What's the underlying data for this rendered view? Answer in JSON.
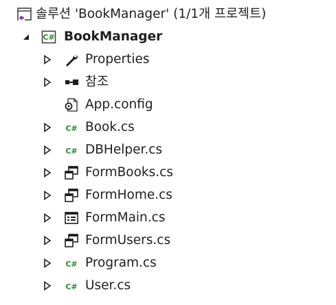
{
  "solution": {
    "label": "솔루션 'BookManager' (1/1개 프로젝트)",
    "icon": "solution-icon"
  },
  "project": {
    "label": "BookManager",
    "icon": "csharp-project-icon",
    "expanded": true
  },
  "items": [
    {
      "label": "Properties",
      "icon": "wrench-icon",
      "expander": true
    },
    {
      "label": "참조",
      "icon": "references-icon",
      "expander": true
    },
    {
      "label": "App.config",
      "icon": "config-file-icon",
      "expander": false
    },
    {
      "label": "Book.cs",
      "icon": "csharp-file-icon",
      "expander": true
    },
    {
      "label": "DBHelper.cs",
      "icon": "csharp-file-icon",
      "expander": true
    },
    {
      "label": "FormBooks.cs",
      "icon": "form-icon",
      "expander": true
    },
    {
      "label": "FormHome.cs",
      "icon": "form-icon",
      "expander": true
    },
    {
      "label": "FormMain.cs",
      "icon": "mdi-form-icon",
      "expander": true
    },
    {
      "label": "FormUsers.cs",
      "icon": "form-icon",
      "expander": true
    },
    {
      "label": "Program.cs",
      "icon": "csharp-file-icon",
      "expander": true
    },
    {
      "label": "User.cs",
      "icon": "csharp-file-icon",
      "expander": true
    }
  ],
  "colors": {
    "text": "#1e1e1e",
    "csharp_green": "#2a8a2a",
    "solution_purple": "#68217a",
    "expander": "#1e1e1e",
    "icon_dark": "#1e1e1e"
  }
}
